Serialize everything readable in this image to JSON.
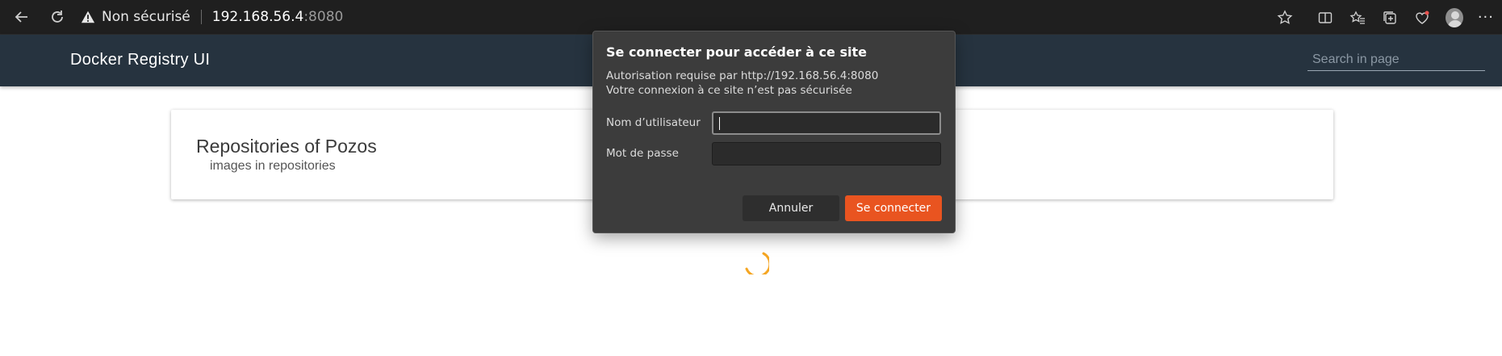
{
  "browser": {
    "security_label": "Non sécurisé",
    "url_host": "192.168.56.4",
    "url_port": ":8080",
    "icons": [
      "back-icon",
      "reload-icon",
      "warning-icon",
      "favorite-star-icon",
      "split-screen-icon",
      "favorites-icon",
      "collections-icon",
      "browser-essentials-icon",
      "profile-icon",
      "more-icon"
    ]
  },
  "app": {
    "title": "Docker Registry UI",
    "search_placeholder": "Search in page"
  },
  "card": {
    "title": "Repositories of Pozos",
    "subtitle": "images in repositories"
  },
  "dialog": {
    "title": "Se connecter pour accéder à ce site",
    "line1": "Autorisation requise par http://192.168.56.4:8080",
    "line2": "Votre connexion à ce site n’est pas sécurisée",
    "username_label": "Nom d’utilisateur",
    "password_label": "Mot de passe",
    "username_value": "",
    "password_value": "",
    "cancel_label": "Annuler",
    "submit_label": "Se connecter"
  },
  "colors": {
    "header_bg": "#26333f",
    "accent": "#e95420",
    "spinner": "#f5a623"
  }
}
